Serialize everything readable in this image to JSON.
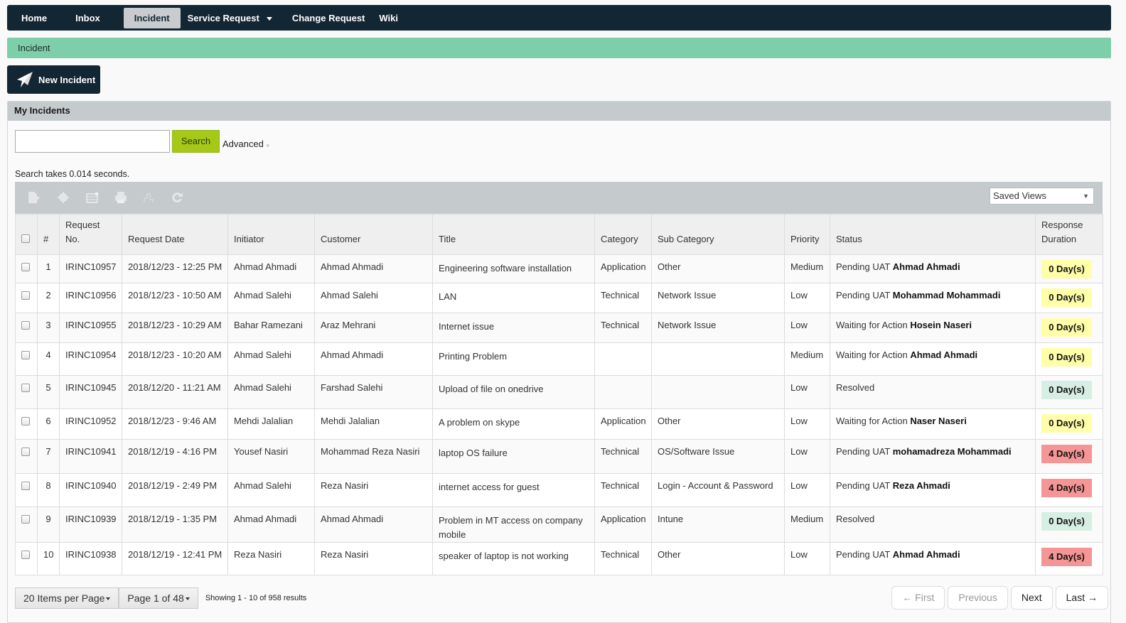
{
  "nav": {
    "items": [
      {
        "label": "Home",
        "active": false
      },
      {
        "label": "Inbox",
        "active": false
      },
      {
        "label": "Incident",
        "active": true
      },
      {
        "label": "Service Request",
        "active": false,
        "dropdown": true
      },
      {
        "label": "Change Request",
        "active": false
      },
      {
        "label": "Wiki",
        "active": false
      }
    ]
  },
  "breadcrumb": "Incident",
  "new_button": {
    "label": "New Incident",
    "icon": "paper-plane-icon"
  },
  "panel": {
    "title": "My Incidents",
    "search": {
      "value": "",
      "placeholder": "",
      "button": "Search",
      "advanced": "Advanced",
      "advanced_suffix": "»"
    },
    "search_time": "Search takes 0.014 seconds.",
    "toolbar_icons": [
      "export-icon",
      "settings-icon",
      "columns-icon",
      "print-icon",
      "chart-icon",
      "refresh-icon"
    ],
    "saved_views": "Saved Views"
  },
  "table": {
    "columns": [
      "",
      "#",
      "Request No.",
      "Request Date",
      "Initiator",
      "Customer",
      "Title",
      "Category",
      "Sub Category",
      "Priority",
      "Status",
      "Response Duration"
    ],
    "rows": [
      {
        "n": "1",
        "req": "IRINC10957",
        "date": "2018/12/23 - 12:25 PM",
        "initiator": "Ahmad Ahmadi",
        "customer": "Ahmad Ahmadi",
        "title": "Engineering software installation",
        "category": "Application",
        "sub": "Other",
        "priority": "Medium",
        "status": "Pending UAT",
        "status_person": "Ahmad Ahmadi",
        "resp": "0 Day(s)",
        "resp_color": "yellow"
      },
      {
        "n": "2",
        "req": "IRINC10956",
        "date": "2018/12/23 - 10:50 AM",
        "initiator": "Ahmad Salehi",
        "customer": "Ahmad Salehi",
        "title": "LAN",
        "category": "Technical",
        "sub": "Network Issue",
        "priority": "Low",
        "status": "Pending UAT",
        "status_person": "Mohammad Mohammadi",
        "resp": "0 Day(s)",
        "resp_color": "yellow"
      },
      {
        "n": "3",
        "req": "IRINC10955",
        "date": "2018/12/23 - 10:29 AM",
        "initiator": "Bahar Ramezani",
        "customer": "Araz Mehrani",
        "title": "Internet issue",
        "category": "Technical",
        "sub": "Network Issue",
        "priority": "Low",
        "status": "Waiting for Action",
        "status_person": "Hosein Naseri",
        "resp": "0 Day(s)",
        "resp_color": "yellow"
      },
      {
        "n": "4",
        "req": "IRINC10954",
        "date": "2018/12/23 - 10:20 AM",
        "initiator": "Ahmad Salehi",
        "customer": "Ahmad Ahmadi",
        "title": "Printing Problem",
        "category": "",
        "sub": "",
        "priority": "Medium",
        "status": "Waiting for Action",
        "status_person": "Ahmad Ahmadi",
        "resp": "0 Day(s)",
        "resp_color": "yellow"
      },
      {
        "n": "5",
        "req": "IRINC10945",
        "date": "2018/12/20 - 11:21 AM",
        "initiator": "Ahmad Salehi",
        "customer": "Farshad Salehi",
        "title": "Upload of file on onedrive",
        "category": "",
        "sub": "",
        "priority": "Low",
        "status": "Resolved",
        "status_person": "",
        "resp": "0 Day(s)",
        "resp_color": "green"
      },
      {
        "n": "6",
        "req": "IRINC10952",
        "date": "2018/12/23 - 9:46 AM",
        "initiator": "Mehdi Jalalian",
        "customer": "Mehdi Jalalian",
        "title": "A problem on skype",
        "category": "Application",
        "sub": "Other",
        "priority": "Low",
        "status": "Waiting for Action",
        "status_person": "Naser Naseri",
        "resp": "0 Day(s)",
        "resp_color": "yellow"
      },
      {
        "n": "7",
        "req": "IRINC10941",
        "date": "2018/12/19 - 4:16 PM",
        "initiator": "Yousef Nasiri",
        "customer": "Mohammad Reza Nasiri",
        "title": "laptop OS failure",
        "category": "Technical",
        "sub": "OS/Software Issue",
        "priority": "Low",
        "status": "Pending UAT",
        "status_person": "mohamadreza Mohammadi",
        "resp": "4 Day(s)",
        "resp_color": "red"
      },
      {
        "n": "8",
        "req": "IRINC10940",
        "date": "2018/12/19 - 2:49 PM",
        "initiator": "Ahmad Salehi",
        "customer": "Reza Nasiri",
        "title": "internet access for guest",
        "category": "Technical",
        "sub": "Login - Account & Password",
        "priority": "Low",
        "status": "Pending UAT",
        "status_person": "Reza Ahmadi",
        "resp": "4 Day(s)",
        "resp_color": "red"
      },
      {
        "n": "9",
        "req": "IRINC10939",
        "date": "2018/12/19 - 1:35 PM",
        "initiator": "Ahmad Ahmadi",
        "customer": "Ahmad Ahmadi",
        "title": "Problem in MT access on company mobile",
        "category": "Application",
        "sub": "Intune",
        "priority": "Medium",
        "status": "Resolved",
        "status_person": "",
        "resp": "0 Day(s)",
        "resp_color": "green"
      },
      {
        "n": "10",
        "req": "IRINC10938",
        "date": "2018/12/19 - 12:41 PM",
        "initiator": "Reza Nasiri",
        "customer": "Reza Nasiri",
        "title": "speaker of laptop is not working",
        "category": "Technical",
        "sub": "Other",
        "priority": "Low",
        "status": "Pending UAT",
        "status_person": "Ahmad Ahmadi",
        "resp": "4 Day(s)",
        "resp_color": "red"
      }
    ]
  },
  "pager": {
    "items_per_page": "20 Items per Page",
    "page": "Page 1 of 48",
    "showing": "Showing 1 - 10 of 958 results",
    "first": "← First",
    "previous": "Previous",
    "next": "Next",
    "last": "Last →"
  },
  "colors": {
    "nav_bg": "#132633",
    "breadcrumb_bg": "#7ecfa9",
    "search_btn": "#a6c917",
    "resp_yellow": "#ffffaa",
    "resp_green": "#d7efe3",
    "resp_red": "#f59595"
  }
}
